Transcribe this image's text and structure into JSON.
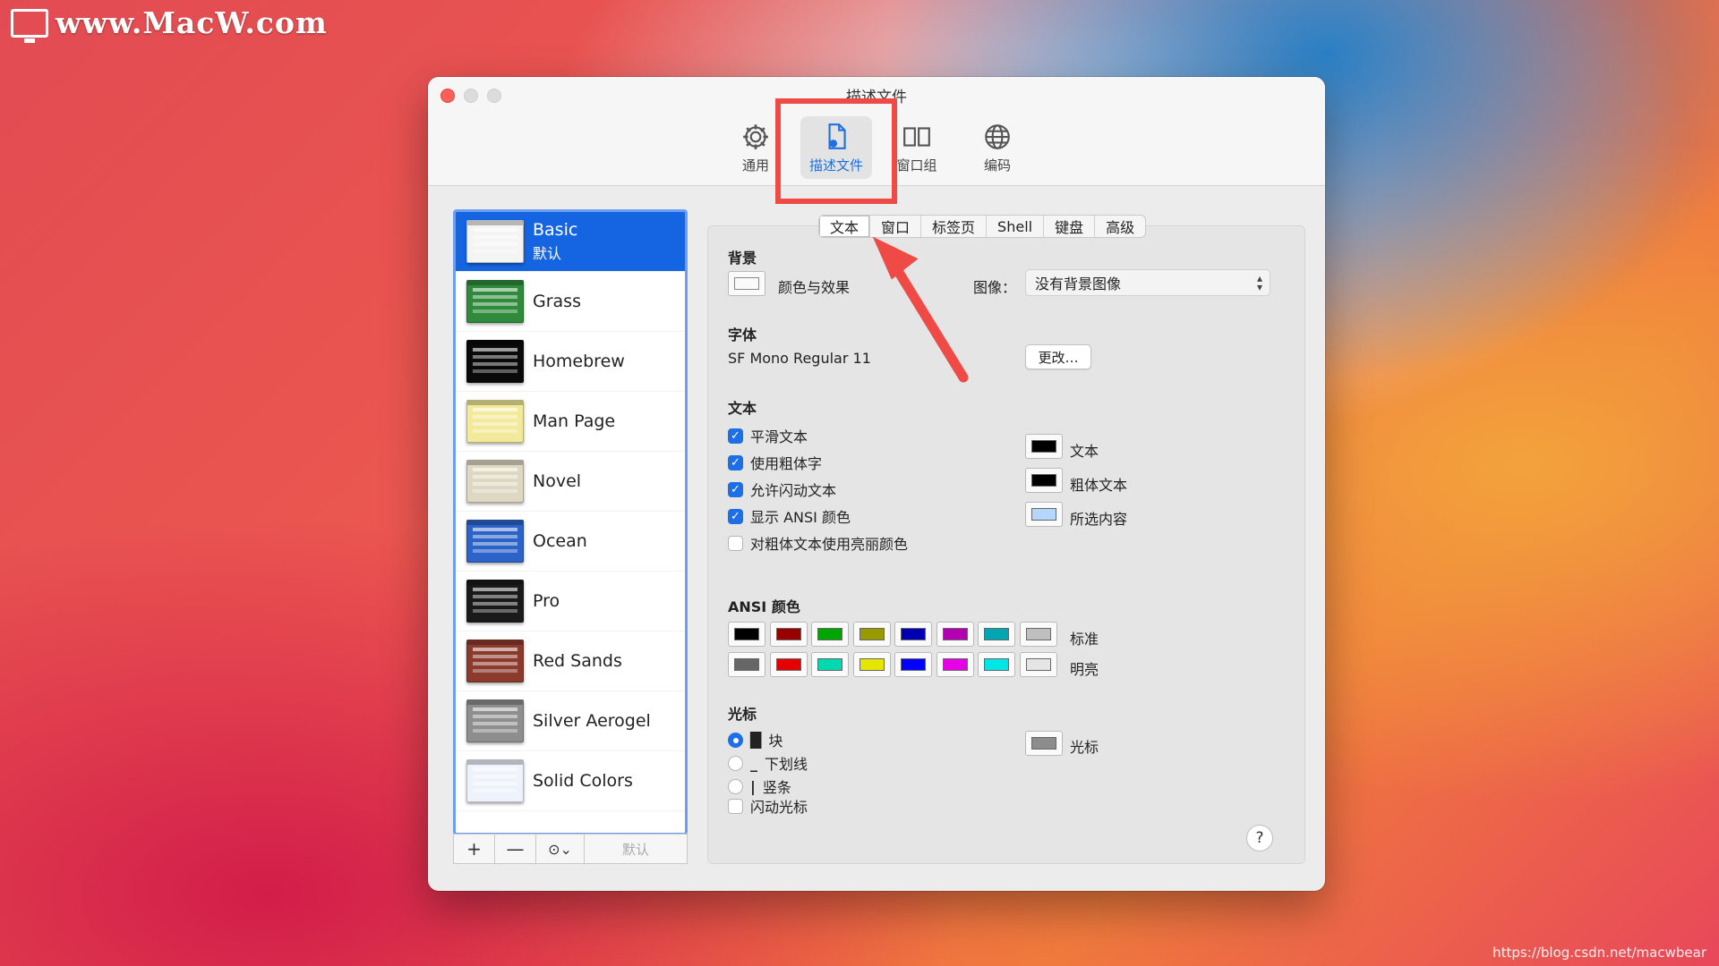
{
  "watermark": "www.MacW.com",
  "credit": "https://blog.csdn.net/macwbear",
  "window": {
    "title": "描述文件"
  },
  "toolbar": [
    {
      "label": "通用",
      "icon": "gear-icon"
    },
    {
      "label": "描述文件",
      "icon": "profile-document-icon",
      "selected": true
    },
    {
      "label": "窗口组",
      "icon": "window-groups-icon"
    },
    {
      "label": "编码",
      "icon": "globe-icon"
    }
  ],
  "profiles": [
    {
      "name": "Basic",
      "sub": "默认",
      "color": "#f4f4f4",
      "selected": true
    },
    {
      "name": "Grass",
      "color": "#2f8a3b"
    },
    {
      "name": "Homebrew",
      "color": "#0a0a0a"
    },
    {
      "name": "Man Page",
      "color": "#f2ea9a"
    },
    {
      "name": "Novel",
      "color": "#ded7c2"
    },
    {
      "name": "Ocean",
      "color": "#2b63c9"
    },
    {
      "name": "Pro",
      "color": "#1a1a1a"
    },
    {
      "name": "Red Sands",
      "color": "#8b3a2c"
    },
    {
      "name": "Silver Aerogel",
      "color": "#8e8e8e"
    },
    {
      "name": "Solid Colors",
      "color": "#eef3fb"
    }
  ],
  "sidebar_footer": {
    "add": "+",
    "remove": "—",
    "more": "⊙⌄",
    "default": "默认"
  },
  "tabs": [
    {
      "label": "文本",
      "selected": true
    },
    {
      "label": "窗口"
    },
    {
      "label": "标签页"
    },
    {
      "label": "Shell"
    },
    {
      "label": "键盘"
    },
    {
      "label": "高级"
    }
  ],
  "background": {
    "section": "背景",
    "color_effects": "颜色与效果",
    "image_label": "图像：",
    "image_value": "没有背景图像"
  },
  "font": {
    "section": "字体",
    "value": "SF Mono Regular 11",
    "change": "更改…"
  },
  "text": {
    "section": "文本",
    "checkboxes": [
      {
        "label": "平滑文本",
        "checked": true
      },
      {
        "label": "使用粗体字",
        "checked": true
      },
      {
        "label": "允许闪动文本",
        "checked": true
      },
      {
        "label": "显示 ANSI 颜色",
        "checked": true
      },
      {
        "label": "对粗体文本使用亮丽颜色",
        "checked": false
      }
    ],
    "colors": [
      {
        "label": "文本",
        "color": "#000000"
      },
      {
        "label": "粗体文本",
        "color": "#000000"
      },
      {
        "label": "所选内容",
        "color": "#b3d7ff"
      }
    ]
  },
  "ansi": {
    "section": "ANSI 颜色",
    "normal_label": "标准",
    "bright_label": "明亮",
    "normal": [
      "#000000",
      "#990000",
      "#00a600",
      "#999900",
      "#0000b2",
      "#b200b2",
      "#00a6b2",
      "#bfbfbf"
    ],
    "bright": [
      "#666666",
      "#e50000",
      "#00d9b0",
      "#e5e500",
      "#0000ff",
      "#e500e5",
      "#00e5e5",
      "#e5e5e5"
    ]
  },
  "cursor": {
    "section": "光标",
    "options": [
      {
        "glyph": "█",
        "label": "块",
        "selected": true
      },
      {
        "glyph": "_",
        "label": "下划线",
        "selected": false
      },
      {
        "glyph": "|",
        "label": "竖条",
        "selected": false
      }
    ],
    "blink": {
      "label": "闪动光标",
      "checked": false
    },
    "color_label": "光标",
    "color": "#8c8c8c"
  },
  "help": "?",
  "colors": {
    "accent": "#1d6fe6",
    "annotation": "#ef4a45"
  }
}
